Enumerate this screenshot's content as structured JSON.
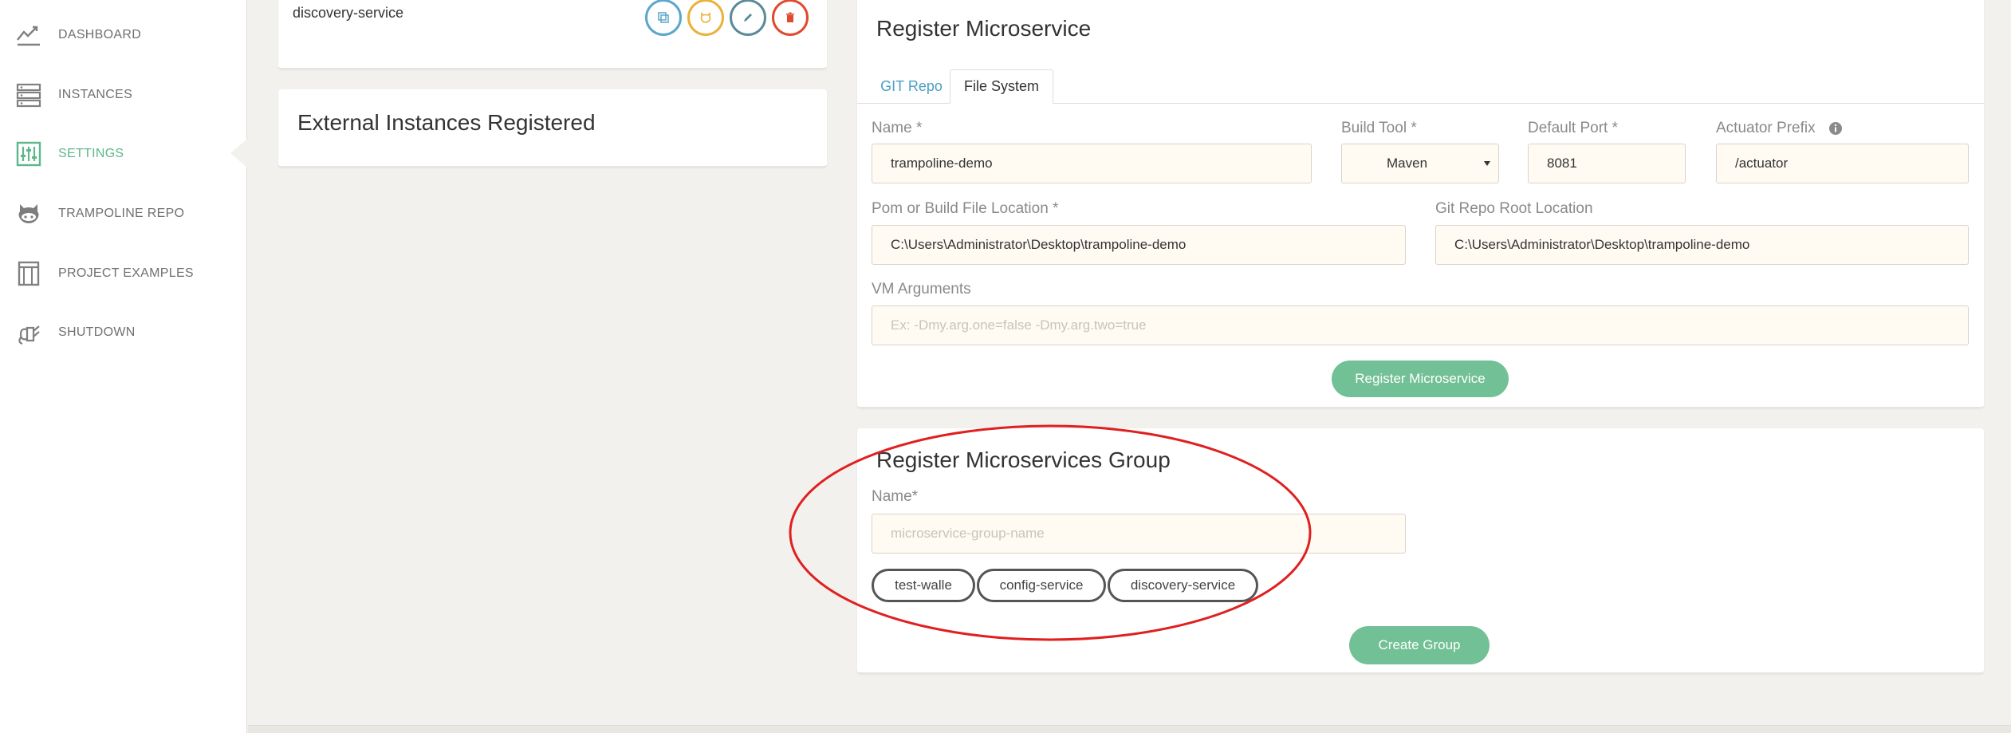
{
  "sidebar": {
    "items": [
      {
        "label": "DASHBOARD",
        "icon": "chart-line-icon"
      },
      {
        "label": "INSTANCES",
        "icon": "server-list-icon"
      },
      {
        "label": "SETTINGS",
        "icon": "sliders-icon",
        "active": true
      },
      {
        "label": "TRAMPOLINE REPO",
        "icon": "github-octocat-icon"
      },
      {
        "label": "PROJECT EXAMPLES",
        "icon": "book-icon"
      },
      {
        "label": "SHUTDOWN",
        "icon": "power-plug-icon"
      }
    ]
  },
  "instance_card": {
    "service_name": "discovery-service",
    "actions": [
      {
        "name": "copy",
        "color": "#5aa7c9"
      },
      {
        "name": "github",
        "color": "#e9b23b"
      },
      {
        "name": "edit",
        "color": "#5b8a99"
      },
      {
        "name": "delete",
        "color": "#e04a2f"
      }
    ]
  },
  "external_instances": {
    "title": "External Instances Registered"
  },
  "register": {
    "title": "Register Microservice",
    "tabs": [
      "GIT Repo",
      "File System"
    ],
    "active_tab": "File System",
    "name_label": "Name *",
    "name_value": "trampoline-demo",
    "build_tool_label": "Build Tool *",
    "build_tool_value": "Maven",
    "port_label": "Default Port *",
    "port_value": "8081",
    "actuator_label": "Actuator Prefix",
    "actuator_value": "/actuator",
    "pom_label": "Pom or Build File Location *",
    "pom_value": "C:\\Users\\Administrator\\Desktop\\trampoline-demo",
    "git_root_label": "Git Repo Root Location",
    "git_root_value": "C:\\Users\\Administrator\\Desktop\\trampoline-demo",
    "vm_label": "VM Arguments",
    "vm_placeholder": "Ex: -Dmy.arg.one=false -Dmy.arg.two=true",
    "submit_label": "Register Microservice"
  },
  "group": {
    "title": "Register Microservices Group",
    "name_label": "Name*",
    "name_placeholder": "microservice-group-name",
    "chips": [
      "test-walle",
      "config-service",
      "discovery-service"
    ],
    "submit_label": "Create Group"
  },
  "colors": {
    "accent_green": "#72c095",
    "active_nav": "#5cb88a",
    "tab_link": "#4a9fc6",
    "annotation_red": "#e02020"
  }
}
